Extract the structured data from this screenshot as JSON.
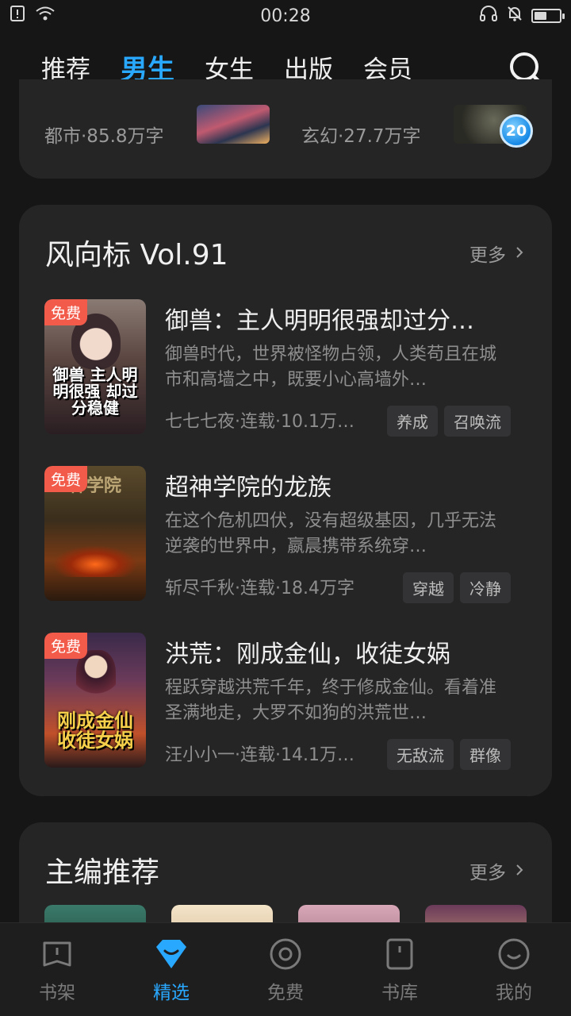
{
  "status": {
    "time": "00:28"
  },
  "tabs": [
    {
      "label": "推荐"
    },
    {
      "label": "男生"
    },
    {
      "label": "女生"
    },
    {
      "label": "出版"
    },
    {
      "label": "会员"
    }
  ],
  "prev_card": {
    "items": [
      {
        "meta": "都市·85.8万字"
      },
      {
        "meta": "玄幻·27.7万字"
      }
    ],
    "badge": "20"
  },
  "section1": {
    "title": "风向标 Vol.91",
    "more": "更多",
    "books": [
      {
        "free": "免费",
        "title": "御兽：主人明明很强却过分…",
        "desc": "御兽时代，世界被怪物占领，人类苟且在城市和高墙之中，既要小心高墙外…",
        "meta": "七七七夜·连载·10.1万…",
        "tags": [
          "养成",
          "召唤流"
        ],
        "cover_text": "御兽 主人明明很强 却过分稳健"
      },
      {
        "free": "免费",
        "title": "超神学院的龙族",
        "desc": "在这个危机四伏，没有超级基因，几乎无法逆袭的世界中，嬴晨携带系统穿…",
        "meta": "斩尽千秋·连载·18.4万字",
        "tags": [
          "穿越",
          "冷静"
        ],
        "cover_text": "神学院"
      },
      {
        "free": "免费",
        "title": "洪荒：刚成金仙，收徒女娲",
        "desc": "程跃穿越洪荒千年，终于修成金仙。看着准圣满地走，大罗不如狗的洪荒世…",
        "meta": "汪小小一·连载·14.1万…",
        "tags": [
          "无敌流",
          "群像"
        ],
        "cover_text": "刚成金仙 收徒女娲"
      }
    ]
  },
  "section2": {
    "title": "主编推荐",
    "more": "更多"
  },
  "nav": [
    {
      "label": "书架"
    },
    {
      "label": "精选"
    },
    {
      "label": "免费"
    },
    {
      "label": "书库"
    },
    {
      "label": "我的"
    }
  ]
}
